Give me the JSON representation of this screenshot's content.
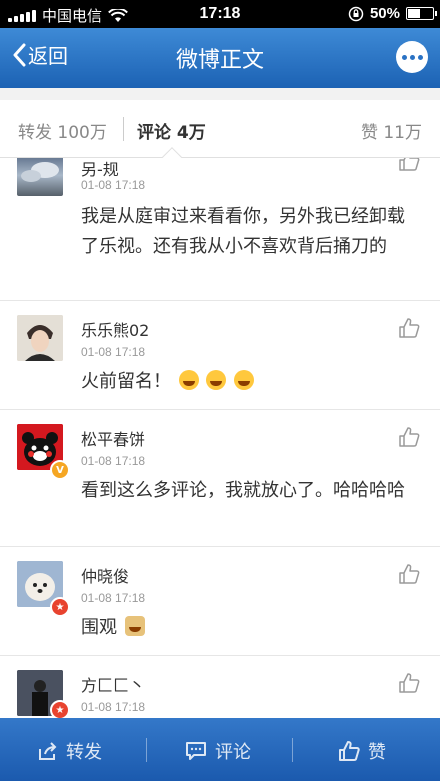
{
  "status_bar": {
    "carrier": "中国电信",
    "time": "17:18",
    "battery": "50%",
    "battery_level": 0.5
  },
  "nav": {
    "back_label": "返回",
    "title": "微博正文"
  },
  "tabs": {
    "repost": "转发 100万",
    "comment": "评论 4万",
    "like": "赞 11万"
  },
  "comments": [
    {
      "name": "另-规",
      "time": "01-08 17:18",
      "text": "我是从庭审过来看看你，另外我已经卸载了乐视。还有我从小不喜欢背后捅刀的",
      "avatar_icon": "sky-avatar"
    },
    {
      "name": "乐乐熊02",
      "time": "01-08 17:18",
      "text": "火前留名！",
      "avatar_icon": "person-avatar",
      "emojis": 3
    },
    {
      "name": "松平春饼",
      "time": "01-08 17:18",
      "text": "看到这么多评论，我就放心了。哈哈哈哈",
      "avatar_icon": "kumamon-avatar",
      "badge": "V"
    },
    {
      "name": "仲晓俊",
      "time": "01-08 17:18",
      "text": "围观",
      "avatar_icon": "dog-avatar",
      "emojis": 1
    },
    {
      "name": "方匚匚丶",
      "time": "01-08 17:18",
      "text": "",
      "avatar_icon": "dark-avatar"
    }
  ],
  "bottom_bar": {
    "repost": "转发",
    "comment": "评论",
    "like": "赞"
  },
  "colors": {
    "nav": "#2a72c4",
    "badge_gold": "#f5a623",
    "badge_red": "#e8432f"
  }
}
